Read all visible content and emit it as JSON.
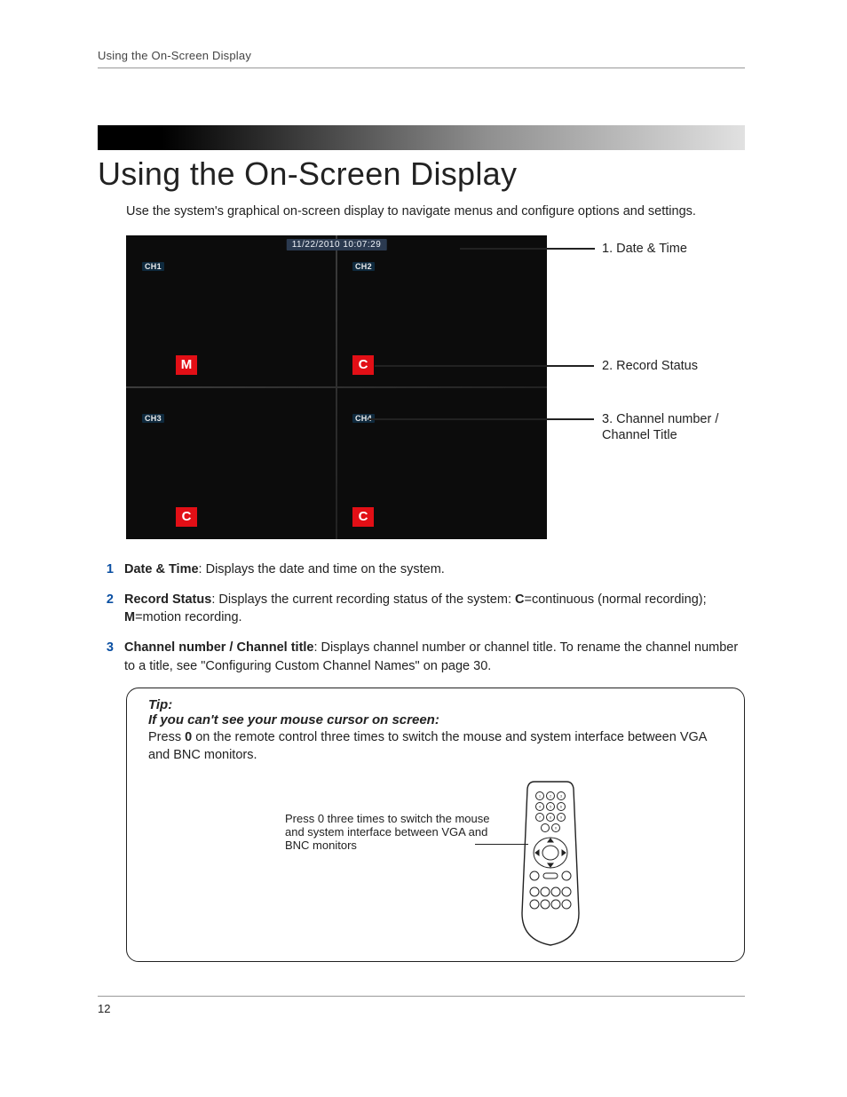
{
  "header": {
    "running_title": "Using the On-Screen Display"
  },
  "title": "Using the On-Screen Display",
  "intro": "Use the system's graphical on-screen display to navigate menus and configure options and settings.",
  "osd": {
    "datetime": "11/22/2010  10:07:29",
    "channels": {
      "ch1": "CH1",
      "ch2": "CH2",
      "ch3": "CH3",
      "ch4": "CH4"
    },
    "rec": {
      "r1": "M",
      "r2": "C",
      "r3": "C",
      "r4": "C"
    }
  },
  "callouts": {
    "c1": "1. Date & Time",
    "c2": "2. Record Status",
    "c3": "3. Channel number / Channel Title"
  },
  "list": {
    "n1_num": "1",
    "n1_term": "Date & Time",
    "n1_rest": ": Displays the date and time on the system.",
    "n2_num": "2",
    "n2_term": "Record Status",
    "n2_rest_a": ": Displays the current recording status of the system: ",
    "n2_b1": "C",
    "n2_rest_b": "=continuous (normal recording); ",
    "n2_b2": "M",
    "n2_rest_c": "=motion recording.",
    "n3_num": "3",
    "n3_term": "Channel number / Channel title",
    "n3_rest": ": Displays channel number or channel title. To rename the channel number to a title, see \"Configuring Custom Channel Names\" on page 30."
  },
  "tip": {
    "head": "Tip:",
    "sub": "If you can't see your mouse cursor on screen:",
    "body_a": "Press ",
    "body_bold": "0",
    "body_b": " on the remote control three times to switch the mouse and system interface between VGA and BNC monitors.",
    "caption": "Press 0 three times to switch the mouse and system interface between VGA and BNC monitors"
  },
  "footer": {
    "page": "12"
  }
}
